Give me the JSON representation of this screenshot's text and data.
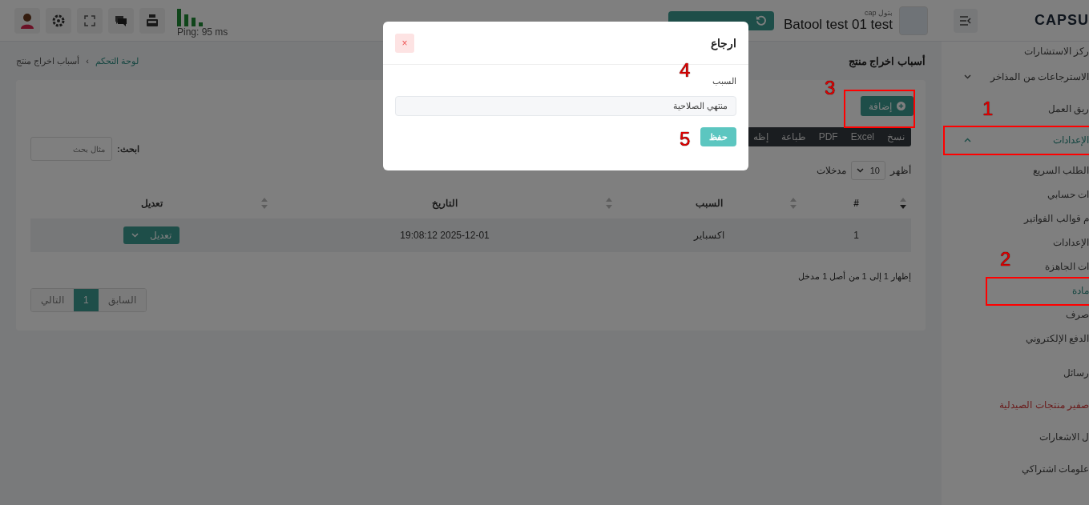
{
  "header": {
    "logo": "CAPSU",
    "user_name": "Batool test 01 test",
    "user_sub": "cap بتول",
    "ping": "Ping: 95 ms"
  },
  "sidebar": {
    "items": [
      {
        "kind": "link",
        "label": "ركز الاستشارات"
      },
      {
        "kind": "group",
        "label": "الاسترجاعات من المذاخر",
        "expanded": false
      },
      {
        "kind": "link",
        "label": "ريق العمل"
      },
      {
        "kind": "group",
        "label": "الإعدادات",
        "expanded": true,
        "children": [
          {
            "label": "الطلب السريع",
            "selected": false
          },
          {
            "label": "ات حسابي",
            "selected": false
          },
          {
            "label": "م قوالب الفواتير",
            "selected": false
          },
          {
            "label": "الإعدادات",
            "selected": false
          },
          {
            "label": "ات الجاهزة",
            "selected": false
          },
          {
            "label": "مادة",
            "selected": true
          },
          {
            "label": "صرف",
            "selected": false
          },
          {
            "label": "الدفع الإلكتروني",
            "selected": false
          }
        ]
      },
      {
        "kind": "link",
        "label": "رسائل"
      },
      {
        "kind": "alert",
        "label": "صفير منتجات الصيدلية"
      },
      {
        "kind": "link",
        "label": "ل الاشعارات"
      },
      {
        "kind": "link",
        "label": "علومات اشتراكي"
      }
    ]
  },
  "page": {
    "title": "أسباب اخراج منتج",
    "breadcrumb_separator": "›",
    "breadcrumb": [
      {
        "label": "لوحة التحكم",
        "link": true
      },
      {
        "label": "أسباب اخراج منتج",
        "link": false
      }
    ]
  },
  "card": {
    "add_button": "إضافة",
    "export_buttons": [
      "نسخ",
      "Excel",
      "PDF",
      "طباعة",
      "إظه"
    ],
    "search_label": "ابحث:",
    "search": {
      "placeholder": "مثال بحث"
    },
    "length": {
      "prefix": "أظهر",
      "value": "10",
      "suffix": "مدخلات"
    },
    "table": {
      "columns": [
        {
          "label": "#",
          "sorted": true
        },
        {
          "label": "السبب",
          "sorted": false
        },
        {
          "label": "التاريخ",
          "sorted": false
        },
        {
          "label": "تعديل",
          "sorted": false
        }
      ],
      "rows": [
        {
          "number": "1",
          "reason": "اكسباير",
          "date": "2025-12-01 19:08:12",
          "action": "تعديل"
        }
      ]
    },
    "info": "إظهار 1 إلى 1 من أصل 1 مدخل",
    "pagination": [
      {
        "label": "السابق",
        "selected": false
      },
      {
        "label": "1",
        "selected": true
      },
      {
        "label": "التالي",
        "selected": false
      }
    ]
  },
  "modal": {
    "title": "ارجاع",
    "close_symbol": "×",
    "field_label": "السبب",
    "field_value": "منتهي الصلاحية",
    "save_button": "حفظ"
  },
  "annotations": [
    {
      "label": "1"
    },
    {
      "label": "2"
    },
    {
      "label": "3"
    },
    {
      "label": "4"
    },
    {
      "label": "5"
    }
  ]
}
